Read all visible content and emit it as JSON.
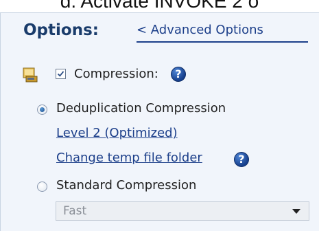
{
  "caption": "d. Activate INVOKE 2 o",
  "options": {
    "title": "Options:",
    "advanced_link": "< Advanced  Options"
  },
  "compression": {
    "icon": "storage-drive-icon",
    "checked": true,
    "label": "Compression:",
    "help_icon": "help-icon"
  },
  "dedup": {
    "selected": true,
    "label": "Deduplication Compression",
    "level_link": "Level 2 (Optimized)",
    "temp_folder_link": "Change temp file folder"
  },
  "standard": {
    "selected": false,
    "label": "Standard Compression",
    "dropdown_value": "Fast"
  },
  "colors": {
    "panel_bg": "#f1f5fb",
    "title": "#1a3c6b",
    "link": "#1c3f8a"
  }
}
